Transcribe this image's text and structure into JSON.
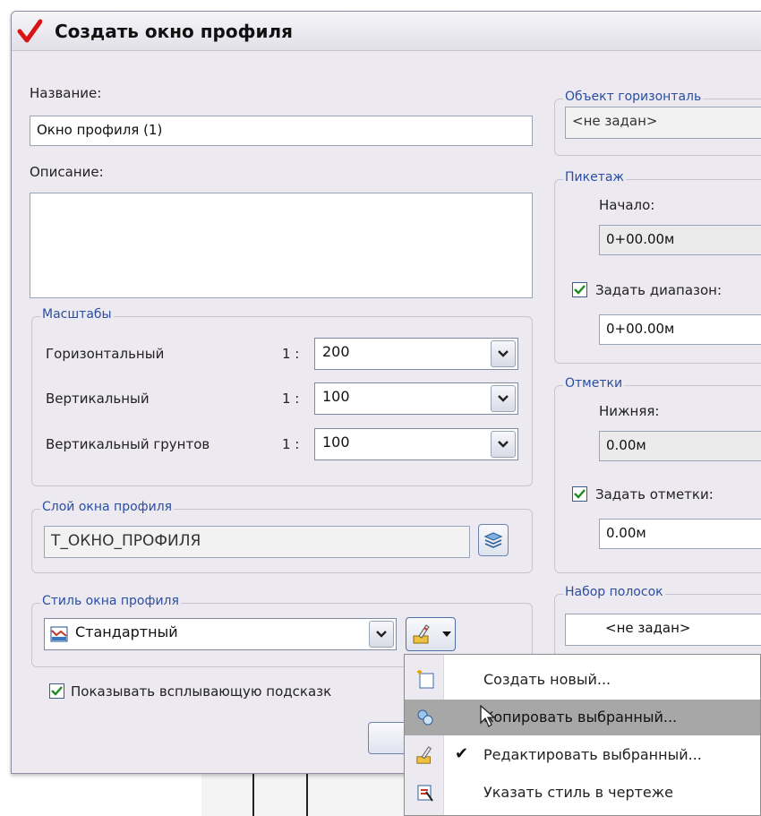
{
  "dialog": {
    "title": "Создать окно профиля"
  },
  "name": {
    "label": "Название:",
    "value": "Окно профиля (1)"
  },
  "description": {
    "label": "Описание:",
    "value": ""
  },
  "scales": {
    "group_label": "Масштабы",
    "rows": [
      {
        "label": "Горизонтальный",
        "prefix": "1 :",
        "value": "200"
      },
      {
        "label": "Вертикальный",
        "prefix": "1 :",
        "value": "100"
      },
      {
        "label": "Вертикальный  грунтов",
        "prefix": "1 :",
        "value": "100"
      }
    ]
  },
  "layer": {
    "group_label": "Слой окна профиля",
    "value": "Т_ОКНО_ПРОФИЛЯ"
  },
  "style": {
    "group_label": "Стиль окна профиля",
    "value": "Стандартный"
  },
  "tooltip_checkbox": {
    "label": "Показывать всплывающую подсказк",
    "checked": true
  },
  "horizontal_object": {
    "group_label": "Объект горизонталь",
    "value": "<не задан>"
  },
  "picket": {
    "group_label": "Пикетаж",
    "start_label": "Начало:",
    "start_value": "0+00.00м",
    "range_checkbox_label": "Задать диапазон:",
    "range_checked": true,
    "range_value": "0+00.00м"
  },
  "elevations": {
    "group_label": "Отметки",
    "lower_label": "Нижняя:",
    "lower_value": "0.00м",
    "set_checkbox_label": "Задать отметки:",
    "set_checked": true,
    "set_value": "0.00м"
  },
  "bands": {
    "group_label": "Набор полосок",
    "value": "<не задан>"
  },
  "style_menu": {
    "items": [
      {
        "label": "Создать новый...",
        "icon": "new-style-icon",
        "checked": false,
        "highlighted": false
      },
      {
        "label": "Копировать выбранный...",
        "icon": "copy-style-icon",
        "checked": false,
        "highlighted": true
      },
      {
        "label": "Редактировать выбранный...",
        "icon": "edit-style-icon",
        "checked": true,
        "highlighted": false
      },
      {
        "label": "Указать стиль в чертеже",
        "icon": "pick-style-icon",
        "checked": false,
        "highlighted": false
      }
    ]
  },
  "colors": {
    "group_label": "#2a4ea2",
    "dialog_bg": "#ede9f0",
    "menu_highlight": "#a7a7a7",
    "title_check": "#d81414"
  }
}
